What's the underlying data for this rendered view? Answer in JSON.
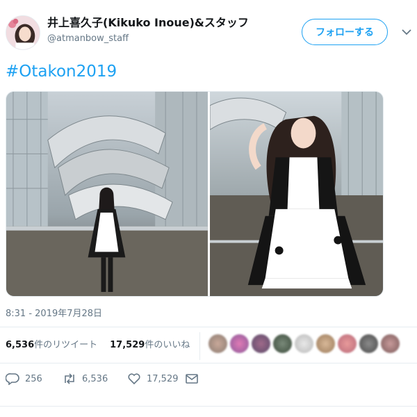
{
  "tweet": {
    "display_name": "井上喜久子(Kikuko Inoue)&スタッフ",
    "handle": "@atmanbow_staff",
    "follow_label": "フォローする",
    "text": "#Otakon2019",
    "timestamp": "8:31 - 2019年7月28日"
  },
  "stats": {
    "retweets_count": "6,536",
    "retweets_label": "件のリツイート",
    "likes_count": "17,529",
    "likes_label": "件のいいね"
  },
  "actions": {
    "reply_count": "256",
    "retweet_count": "6,536",
    "like_count": "17,529"
  },
  "colors": {
    "accent": "#1da1f2",
    "muted": "#657786",
    "text": "#14171a",
    "divider": "#e6ecf0"
  },
  "icons": [
    "chevron-down-icon",
    "reply-icon",
    "retweet-icon",
    "heart-icon",
    "envelope-icon"
  ]
}
